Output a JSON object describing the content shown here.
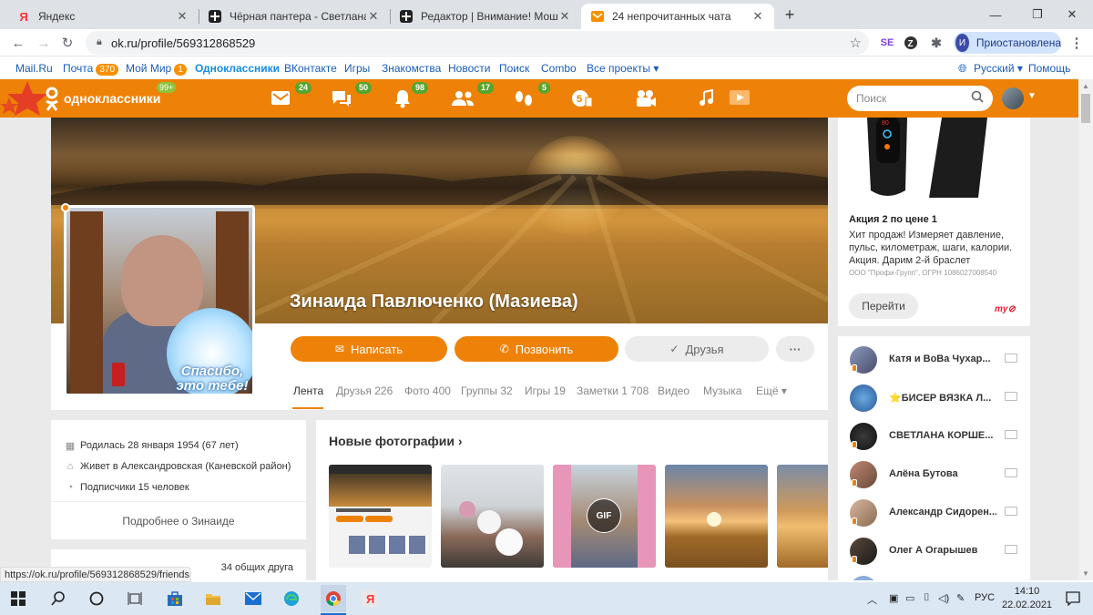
{
  "browser": {
    "tabs": [
      {
        "title": "Яндекс",
        "icon": "yandex-icon"
      },
      {
        "title": "Чёрная пантера - Светлана Хор",
        "icon": "zen-icon"
      },
      {
        "title": "Редактор | Внимание! Мошенн",
        "icon": "zen-icon"
      },
      {
        "title": "24 непрочитанных чата",
        "icon": "mail-icon"
      }
    ],
    "new_tab": "+",
    "url": "ok.ru/profile/569312868529",
    "profile_label": "Приостановлена",
    "profile_initial": "И"
  },
  "mailbar": {
    "items": [
      {
        "label": "Mail.Ru"
      },
      {
        "label": "Почта",
        "badge": "370"
      },
      {
        "label": "Мой Мир",
        "badge": "1"
      },
      {
        "label": "Одноклассники"
      },
      {
        "label": "ВКонтакте"
      },
      {
        "label": "Игры"
      },
      {
        "label": "Знакомства"
      },
      {
        "label": "Новости"
      },
      {
        "label": "Поиск"
      },
      {
        "label": "Combo"
      },
      {
        "label": "Все проекты ▾"
      }
    ],
    "language": "Русский ▾",
    "help": "Помощь"
  },
  "header": {
    "logo_text": "одноклассники",
    "logo_badge": "99+",
    "icons": [
      {
        "name": "messages-icon",
        "badge": "24"
      },
      {
        "name": "discussions-icon",
        "badge": "50"
      },
      {
        "name": "notifications-icon",
        "badge": "98"
      },
      {
        "name": "friends-icon",
        "badge": "17"
      },
      {
        "name": "guests-icon",
        "badge": "5"
      },
      {
        "name": "events-icon",
        "badge": ""
      },
      {
        "name": "video-icon",
        "badge": ""
      },
      {
        "name": "music-icon",
        "badge": ""
      }
    ],
    "search_placeholder": "Поиск"
  },
  "profile": {
    "name": "Зинаида Павлюченко (Мазиева)",
    "avatar_caption": "Спасибо, это тебе!",
    "buttons": {
      "write": "Написать",
      "call": "Позвонить",
      "friends": "Друзья",
      "more": "···"
    },
    "tabs": [
      {
        "label": "Лента"
      },
      {
        "label": "Друзья 226"
      },
      {
        "label": "Фото 400"
      },
      {
        "label": "Группы 32"
      },
      {
        "label": "Игры 19"
      },
      {
        "label": "Заметки 1 708"
      },
      {
        "label": "Видео"
      },
      {
        "label": "Музыка"
      },
      {
        "label": "Ещё ▾"
      }
    ],
    "info": {
      "born": "Родилась 28 января 1954 (67 лет)",
      "lives": "Живет в Александровская (Каневской район)",
      "subscribers": "Подписчики 15 человек",
      "more": "Подробнее о Зинаиде"
    },
    "mutual_friends": "34 общих друга"
  },
  "photos": {
    "title": "Новые фотографии ›",
    "gif_label": "GIF"
  },
  "ad": {
    "title": "Акция 2 по цене 1",
    "text": "Хит продаж! Измеряет давление, пульс, километраж, шаги, калории. Акция. Дарим 2-й браслет",
    "legal": "ООО \"Профи-Групп\", ОГРН 1086027008540",
    "button": "Перейти",
    "band_display": "80",
    "brand": "myTarget"
  },
  "friends_online": [
    {
      "name": "Катя и ВоВа Чухар..."
    },
    {
      "name": "⭐БИСЕР ВЯЗКА Л..."
    },
    {
      "name": "СВЕТЛАНА КОРШЕ..."
    },
    {
      "name": "Алёна Бутова"
    },
    {
      "name": "Александр Сидорен..."
    },
    {
      "name": "Олег А Огарышев"
    }
  ],
  "status_url": "https://ok.ru/profile/569312868529/friends",
  "taskbar": {
    "language": "РУС",
    "time": "14:10",
    "date": "22.02.2021"
  },
  "colors": {
    "ok_orange": "#ee8208",
    "badge_green": "#58a52c",
    "link_blue": "#1a5db8"
  }
}
